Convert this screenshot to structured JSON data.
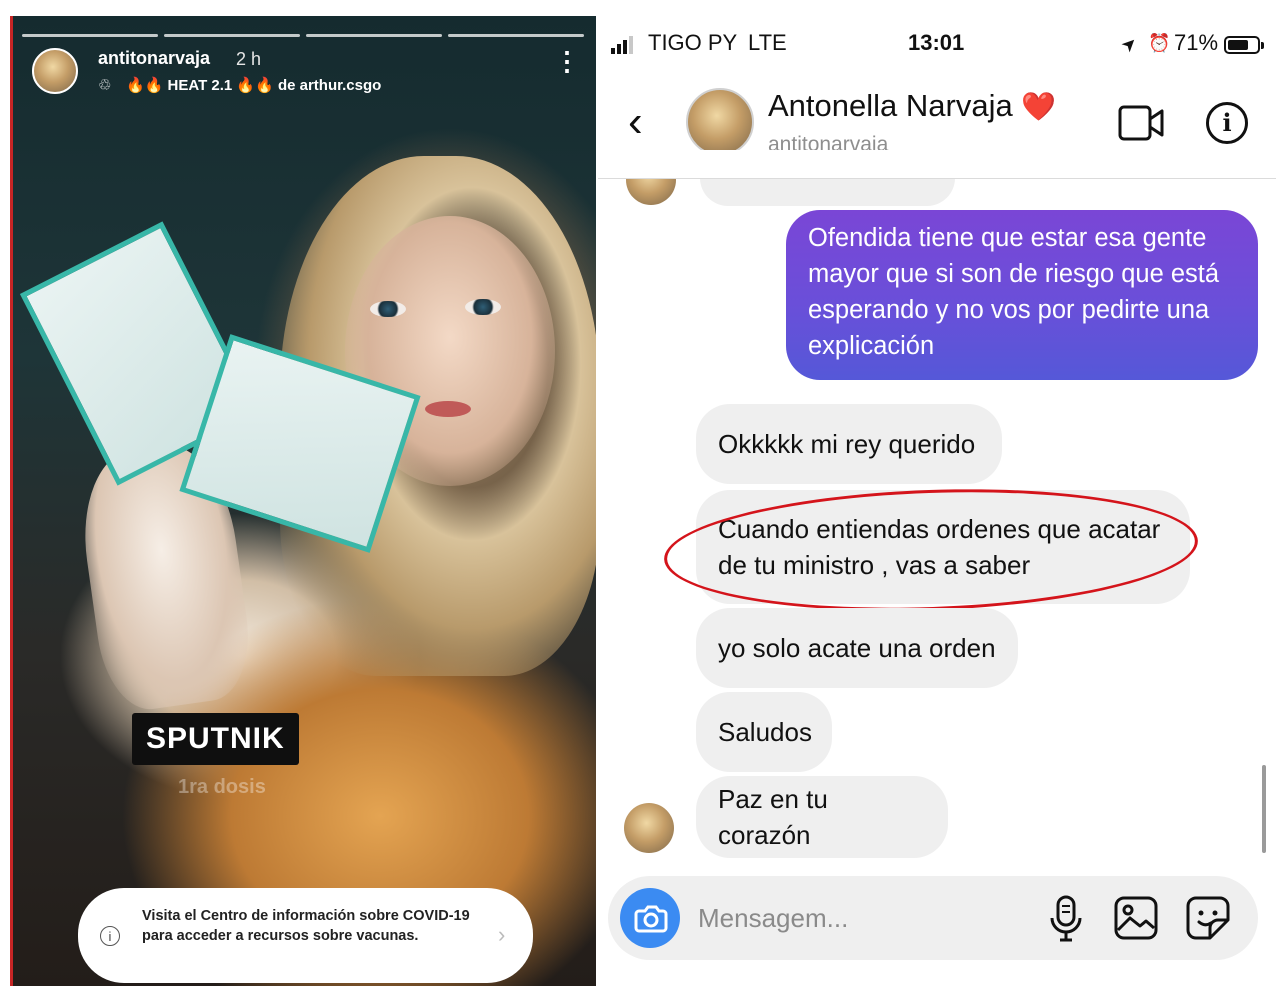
{
  "story": {
    "username": "antitonarvaja",
    "time": "2 h",
    "music_icon": "♲",
    "music_label": "🔥🔥 HEAT 2.1 🔥🔥 de arthur.csgo",
    "more_icon": "⋮",
    "sticker_title": "SPUTNIK",
    "sticker_subtitle": "1ra dosis",
    "covid_icon": "i",
    "covid_text": "Visita el Centro de información sobre COVID-19 para acceder a recursos sobre vacunas.",
    "covid_chevron": "›"
  },
  "status_bar": {
    "carrier": "TIGO PY",
    "network": "LTE",
    "time": "13:01",
    "location_icon": "➤",
    "alarm_icon": "⏰",
    "battery_percent": "71%",
    "battery_level": 0.71
  },
  "header": {
    "back_icon": "‹",
    "name": "Antonella Narvaja",
    "name_emoji": "❤️",
    "username": "antitonarvaja",
    "info_icon": "i"
  },
  "messages": [
    {
      "from": "me",
      "text": "Ofendida tiene que estar esa gente mayor que si son de riesgo que está esperando y no vos por pedirte una explicación"
    },
    {
      "from": "them",
      "text": "Okkkkk mi rey querido"
    },
    {
      "from": "them",
      "text": "Cuando entiendas ordenes que acatar de tu ministro , vas a saber"
    },
    {
      "from": "them",
      "text": "yo solo acate una orden"
    },
    {
      "from": "them",
      "text": "Saludos"
    },
    {
      "from": "them",
      "text": "Paz en tu corazón"
    }
  ],
  "composer": {
    "placeholder": "Mensagem..."
  },
  "colors": {
    "outgoing_bubble": "#6a4fd9",
    "incoming_bubble": "#efefef",
    "camera_button": "#3b8bf2",
    "annotation_ellipse": "#d4141b"
  }
}
